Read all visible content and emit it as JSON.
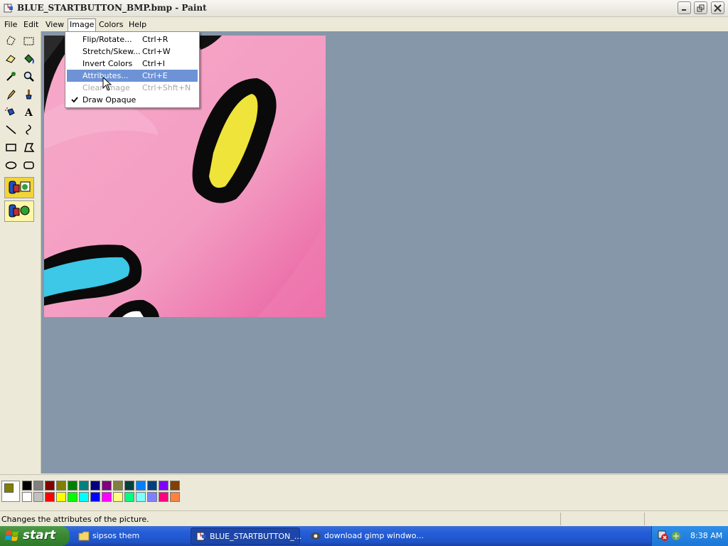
{
  "window": {
    "title": "BLUE_STARTBUTTON_BMP.bmp - Paint",
    "controls": [
      "minimize-icon",
      "restore-icon",
      "close-icon"
    ]
  },
  "menubar": {
    "items": [
      "File",
      "Edit",
      "View",
      "Image",
      "Colors",
      "Help"
    ],
    "open_menu": "Image"
  },
  "image_menu": {
    "items": [
      {
        "label": "Flip/Rotate...",
        "shortcut": "Ctrl+R",
        "state": "normal"
      },
      {
        "label": "Stretch/Skew...",
        "shortcut": "Ctrl+W",
        "state": "normal"
      },
      {
        "label": "Invert Colors",
        "shortcut": "Ctrl+I",
        "state": "normal"
      },
      {
        "label": "Attributes...",
        "shortcut": "Ctrl+E",
        "state": "highlighted"
      },
      {
        "label": "Clear Image",
        "shortcut": "Ctrl+Shft+N",
        "state": "disabled"
      },
      {
        "label": "Draw Opaque",
        "shortcut": "",
        "state": "checked"
      }
    ]
  },
  "toolbox": {
    "tools": [
      "free-form-select",
      "select",
      "eraser",
      "fill-with-color",
      "pick-color",
      "magnifier",
      "pencil",
      "brush",
      "airbrush",
      "text",
      "line",
      "curve",
      "rectangle",
      "polygon",
      "ellipse",
      "rounded-rectangle"
    ]
  },
  "palette": {
    "foreground": "#808000",
    "background": "#ffffff",
    "row1": [
      "#000000",
      "#808080",
      "#800000",
      "#808000",
      "#008000",
      "#008080",
      "#000080",
      "#800080",
      "#808040",
      "#004040",
      "#0080ff",
      "#004080",
      "#8000ff",
      "#804000"
    ],
    "row2": [
      "#ffffff",
      "#c0c0c0",
      "#ff0000",
      "#ffff00",
      "#00ff00",
      "#00ffff",
      "#0000ff",
      "#ff00ff",
      "#ffff80",
      "#00ff80",
      "#80ffff",
      "#8080ff",
      "#ff0080",
      "#ff8040"
    ]
  },
  "statusbar": {
    "message": "Changes the attributes of the picture."
  },
  "taskbar": {
    "start_label": "start",
    "items": [
      {
        "label": "sipsos them",
        "icon": "folder-icon",
        "active": false
      },
      {
        "label": "BLUE_STARTBUTTON_...",
        "icon": "paint-icon",
        "active": true
      },
      {
        "label": "download gimp windwo...",
        "icon": "browser-icon",
        "active": false
      }
    ],
    "clock": "8:38 AM"
  },
  "colors": {
    "canvas_background": "#8797aa",
    "menu_highlight": "#6d93d6",
    "taskbar_blue": "#245edb"
  }
}
